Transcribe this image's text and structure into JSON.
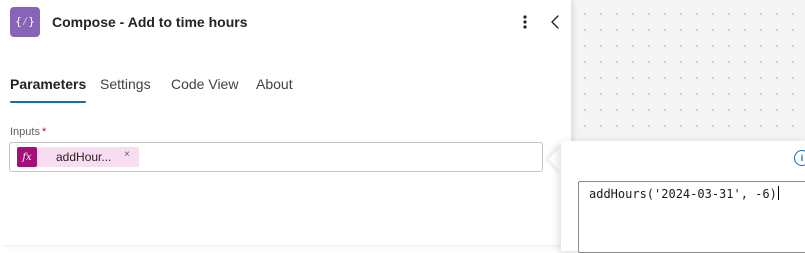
{
  "panel": {
    "title": "Compose - Add to time hours",
    "icon": "compose-curly-braces-icon",
    "icon_glyph": "{⁄}",
    "icon_color": "#8764b8",
    "tabs": [
      {
        "label": "Parameters",
        "active": true
      },
      {
        "label": "Settings",
        "active": false
      },
      {
        "label": "Code View",
        "active": false
      },
      {
        "label": "About",
        "active": false
      }
    ],
    "inputs_label": "Inputs",
    "required_marker": "*",
    "token": {
      "icon_glyph": "fx",
      "label": "addHour...",
      "remove": "×",
      "color": "#a4107a",
      "background": "#f8dcef"
    }
  },
  "expression_editor": {
    "info_glyph": "i",
    "value": "addHours('2024-03-31', -6)"
  },
  "colors": {
    "accent": "#0f6cbd",
    "canvas": "#f4f4f4"
  }
}
